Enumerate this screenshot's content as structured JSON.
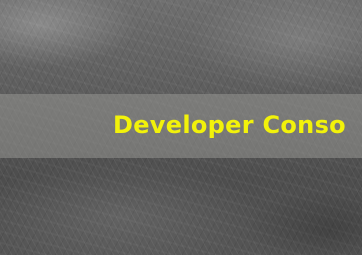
{
  "banner": {
    "title": "Developer Conso"
  },
  "colors": {
    "title_text": "#f2f20a",
    "band": "#969691",
    "background": "#5a5a5a"
  }
}
